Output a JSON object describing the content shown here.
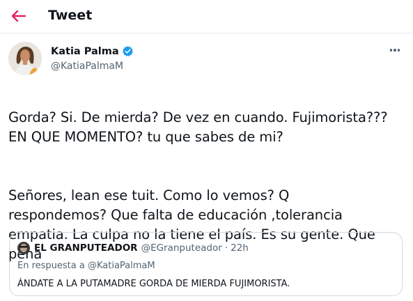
{
  "header": {
    "title": "Tweet",
    "back_icon": "arrow-left-icon",
    "accent_color": "#e0245e"
  },
  "author": {
    "name": "Katia Palma",
    "handle": "@KatiaPalmaM",
    "verified": true,
    "verified_color": "#1d9bf0",
    "more_icon": "more-horizontal-icon"
  },
  "tweet": {
    "paragraph1": "Gorda? Si. De mierda? De vez en cuando. Fujimorista???\nEN QUE MOMENTO? tu que sabes de mi?",
    "paragraph2": "Señores, lean ese tuit. Como lo vemos? Q\nrespondemos? Que falta de educación ,tolerancia\nempatia. La culpa no la tiene el país. Es su gente. Que\npena"
  },
  "quoted_tweet": {
    "name": "EL GRANPUTEADOR",
    "handle": "@EGranputeador",
    "separator": "·",
    "time": "22h",
    "reply_prefix": "En respuesta a",
    "reply_to": "@KatiaPalmaM",
    "text": "ÁNDATE A LA PUTAMADRE GORDA DE MIERDA FUJIMORISTA."
  }
}
